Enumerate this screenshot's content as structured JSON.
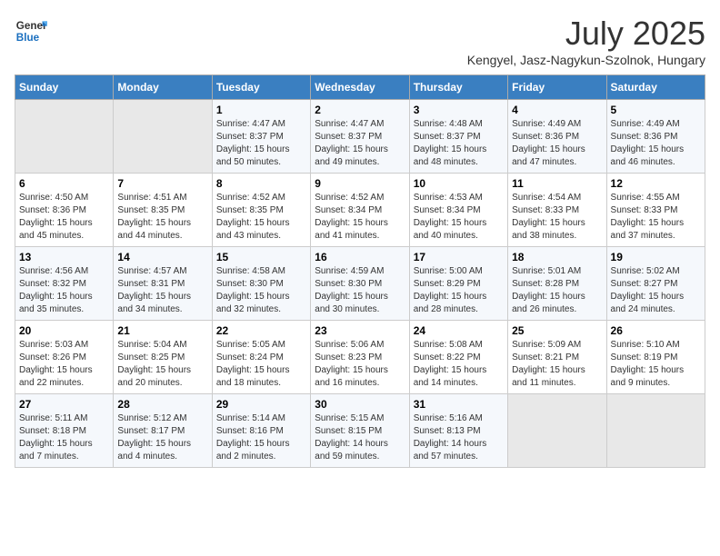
{
  "header": {
    "logo_line1": "General",
    "logo_line2": "Blue",
    "month": "July 2025",
    "location": "Kengyel, Jasz-Nagykun-Szolnok, Hungary"
  },
  "weekdays": [
    "Sunday",
    "Monday",
    "Tuesday",
    "Wednesday",
    "Thursday",
    "Friday",
    "Saturday"
  ],
  "weeks": [
    [
      {
        "day": "",
        "sunrise": "",
        "sunset": "",
        "daylight": ""
      },
      {
        "day": "",
        "sunrise": "",
        "sunset": "",
        "daylight": ""
      },
      {
        "day": "1",
        "sunrise": "Sunrise: 4:47 AM",
        "sunset": "Sunset: 8:37 PM",
        "daylight": "Daylight: 15 hours and 50 minutes."
      },
      {
        "day": "2",
        "sunrise": "Sunrise: 4:47 AM",
        "sunset": "Sunset: 8:37 PM",
        "daylight": "Daylight: 15 hours and 49 minutes."
      },
      {
        "day": "3",
        "sunrise": "Sunrise: 4:48 AM",
        "sunset": "Sunset: 8:37 PM",
        "daylight": "Daylight: 15 hours and 48 minutes."
      },
      {
        "day": "4",
        "sunrise": "Sunrise: 4:49 AM",
        "sunset": "Sunset: 8:36 PM",
        "daylight": "Daylight: 15 hours and 47 minutes."
      },
      {
        "day": "5",
        "sunrise": "Sunrise: 4:49 AM",
        "sunset": "Sunset: 8:36 PM",
        "daylight": "Daylight: 15 hours and 46 minutes."
      }
    ],
    [
      {
        "day": "6",
        "sunrise": "Sunrise: 4:50 AM",
        "sunset": "Sunset: 8:36 PM",
        "daylight": "Daylight: 15 hours and 45 minutes."
      },
      {
        "day": "7",
        "sunrise": "Sunrise: 4:51 AM",
        "sunset": "Sunset: 8:35 PM",
        "daylight": "Daylight: 15 hours and 44 minutes."
      },
      {
        "day": "8",
        "sunrise": "Sunrise: 4:52 AM",
        "sunset": "Sunset: 8:35 PM",
        "daylight": "Daylight: 15 hours and 43 minutes."
      },
      {
        "day": "9",
        "sunrise": "Sunrise: 4:52 AM",
        "sunset": "Sunset: 8:34 PM",
        "daylight": "Daylight: 15 hours and 41 minutes."
      },
      {
        "day": "10",
        "sunrise": "Sunrise: 4:53 AM",
        "sunset": "Sunset: 8:34 PM",
        "daylight": "Daylight: 15 hours and 40 minutes."
      },
      {
        "day": "11",
        "sunrise": "Sunrise: 4:54 AM",
        "sunset": "Sunset: 8:33 PM",
        "daylight": "Daylight: 15 hours and 38 minutes."
      },
      {
        "day": "12",
        "sunrise": "Sunrise: 4:55 AM",
        "sunset": "Sunset: 8:33 PM",
        "daylight": "Daylight: 15 hours and 37 minutes."
      }
    ],
    [
      {
        "day": "13",
        "sunrise": "Sunrise: 4:56 AM",
        "sunset": "Sunset: 8:32 PM",
        "daylight": "Daylight: 15 hours and 35 minutes."
      },
      {
        "day": "14",
        "sunrise": "Sunrise: 4:57 AM",
        "sunset": "Sunset: 8:31 PM",
        "daylight": "Daylight: 15 hours and 34 minutes."
      },
      {
        "day": "15",
        "sunrise": "Sunrise: 4:58 AM",
        "sunset": "Sunset: 8:30 PM",
        "daylight": "Daylight: 15 hours and 32 minutes."
      },
      {
        "day": "16",
        "sunrise": "Sunrise: 4:59 AM",
        "sunset": "Sunset: 8:30 PM",
        "daylight": "Daylight: 15 hours and 30 minutes."
      },
      {
        "day": "17",
        "sunrise": "Sunrise: 5:00 AM",
        "sunset": "Sunset: 8:29 PM",
        "daylight": "Daylight: 15 hours and 28 minutes."
      },
      {
        "day": "18",
        "sunrise": "Sunrise: 5:01 AM",
        "sunset": "Sunset: 8:28 PM",
        "daylight": "Daylight: 15 hours and 26 minutes."
      },
      {
        "day": "19",
        "sunrise": "Sunrise: 5:02 AM",
        "sunset": "Sunset: 8:27 PM",
        "daylight": "Daylight: 15 hours and 24 minutes."
      }
    ],
    [
      {
        "day": "20",
        "sunrise": "Sunrise: 5:03 AM",
        "sunset": "Sunset: 8:26 PM",
        "daylight": "Daylight: 15 hours and 22 minutes."
      },
      {
        "day": "21",
        "sunrise": "Sunrise: 5:04 AM",
        "sunset": "Sunset: 8:25 PM",
        "daylight": "Daylight: 15 hours and 20 minutes."
      },
      {
        "day": "22",
        "sunrise": "Sunrise: 5:05 AM",
        "sunset": "Sunset: 8:24 PM",
        "daylight": "Daylight: 15 hours and 18 minutes."
      },
      {
        "day": "23",
        "sunrise": "Sunrise: 5:06 AM",
        "sunset": "Sunset: 8:23 PM",
        "daylight": "Daylight: 15 hours and 16 minutes."
      },
      {
        "day": "24",
        "sunrise": "Sunrise: 5:08 AM",
        "sunset": "Sunset: 8:22 PM",
        "daylight": "Daylight: 15 hours and 14 minutes."
      },
      {
        "day": "25",
        "sunrise": "Sunrise: 5:09 AM",
        "sunset": "Sunset: 8:21 PM",
        "daylight": "Daylight: 15 hours and 11 minutes."
      },
      {
        "day": "26",
        "sunrise": "Sunrise: 5:10 AM",
        "sunset": "Sunset: 8:19 PM",
        "daylight": "Daylight: 15 hours and 9 minutes."
      }
    ],
    [
      {
        "day": "27",
        "sunrise": "Sunrise: 5:11 AM",
        "sunset": "Sunset: 8:18 PM",
        "daylight": "Daylight: 15 hours and 7 minutes."
      },
      {
        "day": "28",
        "sunrise": "Sunrise: 5:12 AM",
        "sunset": "Sunset: 8:17 PM",
        "daylight": "Daylight: 15 hours and 4 minutes."
      },
      {
        "day": "29",
        "sunrise": "Sunrise: 5:14 AM",
        "sunset": "Sunset: 8:16 PM",
        "daylight": "Daylight: 15 hours and 2 minutes."
      },
      {
        "day": "30",
        "sunrise": "Sunrise: 5:15 AM",
        "sunset": "Sunset: 8:15 PM",
        "daylight": "Daylight: 14 hours and 59 minutes."
      },
      {
        "day": "31",
        "sunrise": "Sunrise: 5:16 AM",
        "sunset": "Sunset: 8:13 PM",
        "daylight": "Daylight: 14 hours and 57 minutes."
      },
      {
        "day": "",
        "sunrise": "",
        "sunset": "",
        "daylight": ""
      },
      {
        "day": "",
        "sunrise": "",
        "sunset": "",
        "daylight": ""
      }
    ]
  ]
}
